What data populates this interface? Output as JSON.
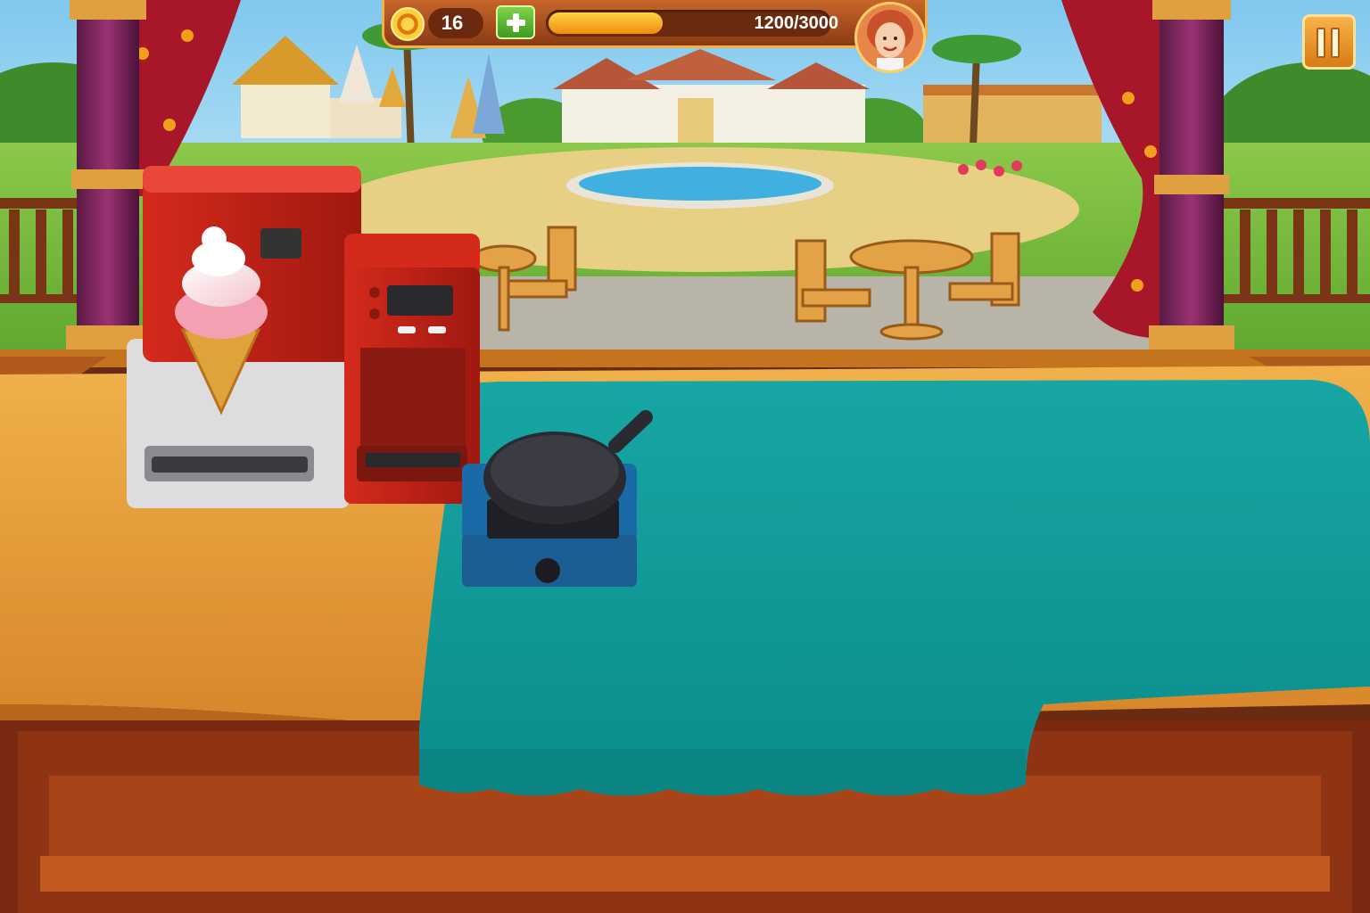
{
  "hud": {
    "coins": "16",
    "score_text": "1200/3000",
    "score_progress": 0.4
  },
  "icons": {
    "coin": "coin-icon",
    "add": "plus-icon",
    "pause": "pause-icon",
    "avatar": "chef-avatar"
  },
  "colors": {
    "tablecloth": "#0f9d9a",
    "counter_wood": "#e0982e",
    "progress_fill": "#f4a214",
    "add_button": "#5cbc2a"
  }
}
